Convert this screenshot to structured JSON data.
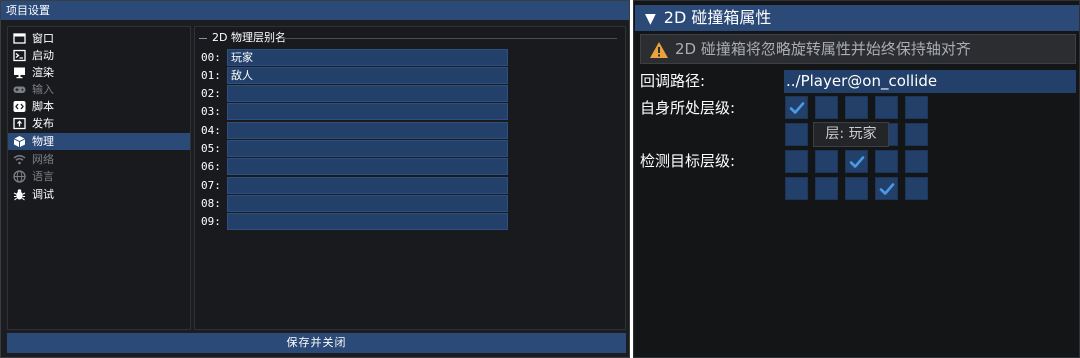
{
  "left_panel": {
    "window_title": "项目设置",
    "sidebar": {
      "items": [
        {
          "label": "窗口",
          "icon": "window-icon",
          "state": "normal"
        },
        {
          "label": "启动",
          "icon": "terminal-icon",
          "state": "normal"
        },
        {
          "label": "渲染",
          "icon": "monitor-icon",
          "state": "normal"
        },
        {
          "label": "输入",
          "icon": "gamepad-icon",
          "state": "disabled"
        },
        {
          "label": "脚本",
          "icon": "code-icon",
          "state": "normal"
        },
        {
          "label": "发布",
          "icon": "package-icon",
          "state": "normal"
        },
        {
          "label": "物理",
          "icon": "cube-icon",
          "state": "selected"
        },
        {
          "label": "网络",
          "icon": "wifi-icon",
          "state": "disabled"
        },
        {
          "label": "语言",
          "icon": "globe-icon",
          "state": "disabled"
        },
        {
          "label": "调试",
          "icon": "bug-icon",
          "state": "normal"
        }
      ]
    },
    "layers_group": {
      "title": "2D 物理层别名",
      "rows": [
        {
          "index": "00:",
          "value": "玩家"
        },
        {
          "index": "01:",
          "value": "敌人"
        },
        {
          "index": "02:",
          "value": ""
        },
        {
          "index": "03:",
          "value": ""
        },
        {
          "index": "04:",
          "value": ""
        },
        {
          "index": "05:",
          "value": ""
        },
        {
          "index": "06:",
          "value": ""
        },
        {
          "index": "07:",
          "value": ""
        },
        {
          "index": "08:",
          "value": ""
        },
        {
          "index": "09:",
          "value": ""
        }
      ]
    },
    "save_button_label": "保存并关闭"
  },
  "right_panel": {
    "header": {
      "arrow": "▼",
      "title": "2D 碰撞箱属性"
    },
    "warning": {
      "text": "2D 碰撞箱将忽略旋转属性并始终保持轴对齐",
      "icon": "warning-icon"
    },
    "callback": {
      "label": "回调路径:",
      "value": "../Player@on_collide"
    },
    "self_layer": {
      "label": "自身所处层级:",
      "checked": [
        [
          true,
          false,
          false,
          false,
          false
        ],
        [
          false,
          false,
          false,
          false,
          false
        ]
      ]
    },
    "tooltip": "层: 玩家",
    "target_layer": {
      "label": "检测目标层级:",
      "checked": [
        [
          false,
          false,
          true,
          false,
          false
        ],
        [
          false,
          false,
          false,
          true,
          false
        ]
      ]
    }
  },
  "colors": {
    "accent": "#2b4a78",
    "field": "#23406a",
    "panel_bg": "#1b1d20",
    "check": "#4a9ae8",
    "warning": "#e8a33c"
  }
}
